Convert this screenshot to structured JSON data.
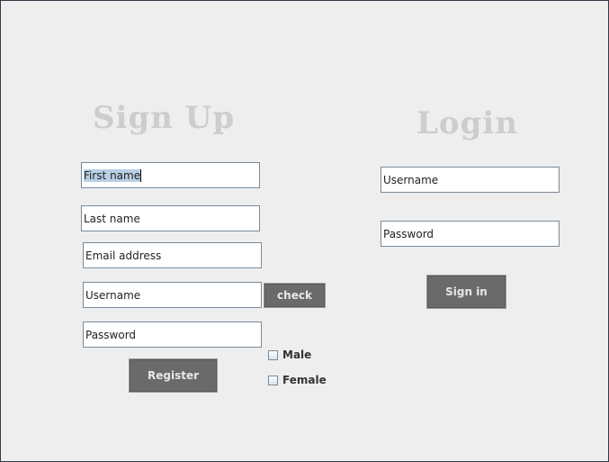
{
  "signup": {
    "title": "Sign Up",
    "first_name": "First name",
    "last_name": "Last name",
    "email": "Email address",
    "username": "Username",
    "password": "Password",
    "check_label": "check",
    "register_label": "Register",
    "gender": {
      "male": "Male",
      "female": "Female"
    }
  },
  "login": {
    "title": "Login",
    "username": "Username",
    "password": "Password",
    "signin_label": "Sign in"
  }
}
